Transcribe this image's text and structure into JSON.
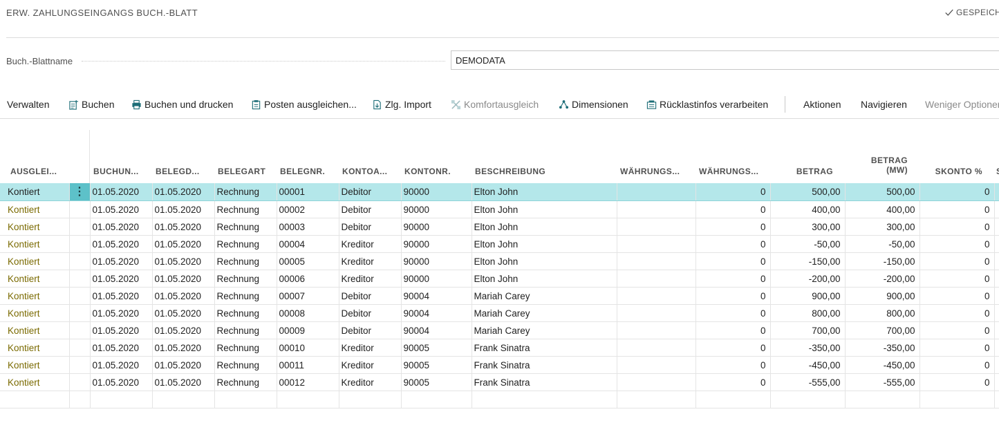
{
  "header": {
    "title": "ERW. ZAHLUNGSEINGANGS BUCH.-BLATT",
    "saved_label": "GESPEICHERT"
  },
  "batch": {
    "label": "Buch.-Blattname",
    "value": "DEMODATA"
  },
  "toolbar": {
    "manage": "Verwalten",
    "post": "Buchen",
    "post_print": "Buchen und drucken",
    "apply_entries": "Posten ausgleichen...",
    "import": "Zlg. Import",
    "comfort_apply": "Komfortausgleich",
    "dimensions": "Dimensionen",
    "return_info": "Rücklastinfos verarbeiten",
    "actions": "Aktionen",
    "navigate": "Navigieren",
    "fewer_options": "Weniger Optionen"
  },
  "icons": {
    "post": "post-icon",
    "post_print": "printer-icon",
    "apply_entries": "apply-entries-icon",
    "import": "import-icon",
    "comfort_apply": "comfort-apply-icon",
    "dimensions": "dimensions-icon",
    "return_info": "return-info-icon",
    "saved": "checkmark-icon"
  },
  "colors": {
    "accent": "#b4e7ea",
    "menu_cell": "#5dc1c9",
    "status_text": "#7a6a00"
  },
  "columns": {
    "applied": "AUSGLEI...",
    "posting_date": "BUCHUN...",
    "document_date": "BELEGD...",
    "document_type": "BELEGART",
    "document_no": "BELEGNR.",
    "account_type": "KONTOA...",
    "account_no": "KONTONR.",
    "description": "BESCHREIBUNG",
    "currency_code": "WÄHRUNGS...",
    "currency_factor": "WÄHRUNGS...",
    "amount": "BETRAG",
    "amount_lcy": "BETRAG (MW)",
    "discount_pct": "SKONTO %",
    "next": "S"
  },
  "rows": [
    {
      "status": "Kontiert",
      "posting_date": "01.05.2020",
      "document_date": "01.05.2020",
      "doc_type": "Rechnung",
      "doc_no": "00001",
      "account_type": "Debitor",
      "account_no": "90000",
      "description": "Elton John",
      "currency_factor": "0",
      "amount": "500,00",
      "amount_lcy": "500,00",
      "discount": "0"
    },
    {
      "status": "Kontiert",
      "posting_date": "01.05.2020",
      "document_date": "01.05.2020",
      "doc_type": "Rechnung",
      "doc_no": "00002",
      "account_type": "Debitor",
      "account_no": "90000",
      "description": "Elton John",
      "currency_factor": "0",
      "amount": "400,00",
      "amount_lcy": "400,00",
      "discount": "0"
    },
    {
      "status": "Kontiert",
      "posting_date": "01.05.2020",
      "document_date": "01.05.2020",
      "doc_type": "Rechnung",
      "doc_no": "00003",
      "account_type": "Debitor",
      "account_no": "90000",
      "description": "Elton John",
      "currency_factor": "0",
      "amount": "300,00",
      "amount_lcy": "300,00",
      "discount": "0"
    },
    {
      "status": "Kontiert",
      "posting_date": "01.05.2020",
      "document_date": "01.05.2020",
      "doc_type": "Rechnung",
      "doc_no": "00004",
      "account_type": "Kreditor",
      "account_no": "90000",
      "description": "Elton John",
      "currency_factor": "0",
      "amount": "-50,00",
      "amount_lcy": "-50,00",
      "discount": "0"
    },
    {
      "status": "Kontiert",
      "posting_date": "01.05.2020",
      "document_date": "01.05.2020",
      "doc_type": "Rechnung",
      "doc_no": "00005",
      "account_type": "Kreditor",
      "account_no": "90000",
      "description": "Elton John",
      "currency_factor": "0",
      "amount": "-150,00",
      "amount_lcy": "-150,00",
      "discount": "0"
    },
    {
      "status": "Kontiert",
      "posting_date": "01.05.2020",
      "document_date": "01.05.2020",
      "doc_type": "Rechnung",
      "doc_no": "00006",
      "account_type": "Kreditor",
      "account_no": "90000",
      "description": "Elton John",
      "currency_factor": "0",
      "amount": "-200,00",
      "amount_lcy": "-200,00",
      "discount": "0"
    },
    {
      "status": "Kontiert",
      "posting_date": "01.05.2020",
      "document_date": "01.05.2020",
      "doc_type": "Rechnung",
      "doc_no": "00007",
      "account_type": "Debitor",
      "account_no": "90004",
      "description": "Mariah Carey",
      "currency_factor": "0",
      "amount": "900,00",
      "amount_lcy": "900,00",
      "discount": "0"
    },
    {
      "status": "Kontiert",
      "posting_date": "01.05.2020",
      "document_date": "01.05.2020",
      "doc_type": "Rechnung",
      "doc_no": "00008",
      "account_type": "Debitor",
      "account_no": "90004",
      "description": "Mariah Carey",
      "currency_factor": "0",
      "amount": "800,00",
      "amount_lcy": "800,00",
      "discount": "0"
    },
    {
      "status": "Kontiert",
      "posting_date": "01.05.2020",
      "document_date": "01.05.2020",
      "doc_type": "Rechnung",
      "doc_no": "00009",
      "account_type": "Debitor",
      "account_no": "90004",
      "description": "Mariah Carey",
      "currency_factor": "0",
      "amount": "700,00",
      "amount_lcy": "700,00",
      "discount": "0"
    },
    {
      "status": "Kontiert",
      "posting_date": "01.05.2020",
      "document_date": "01.05.2020",
      "doc_type": "Rechnung",
      "doc_no": "00010",
      "account_type": "Kreditor",
      "account_no": "90005",
      "description": "Frank Sinatra",
      "currency_factor": "0",
      "amount": "-350,00",
      "amount_lcy": "-350,00",
      "discount": "0"
    },
    {
      "status": "Kontiert",
      "posting_date": "01.05.2020",
      "document_date": "01.05.2020",
      "doc_type": "Rechnung",
      "doc_no": "00011",
      "account_type": "Kreditor",
      "account_no": "90005",
      "description": "Frank Sinatra",
      "currency_factor": "0",
      "amount": "-450,00",
      "amount_lcy": "-450,00",
      "discount": "0"
    },
    {
      "status": "Kontiert",
      "posting_date": "01.05.2020",
      "document_date": "01.05.2020",
      "doc_type": "Rechnung",
      "doc_no": "00012",
      "account_type": "Kreditor",
      "account_no": "90005",
      "description": "Frank Sinatra",
      "currency_factor": "0",
      "amount": "-555,00",
      "amount_lcy": "-555,00",
      "discount": "0"
    }
  ],
  "selected_row": 0
}
